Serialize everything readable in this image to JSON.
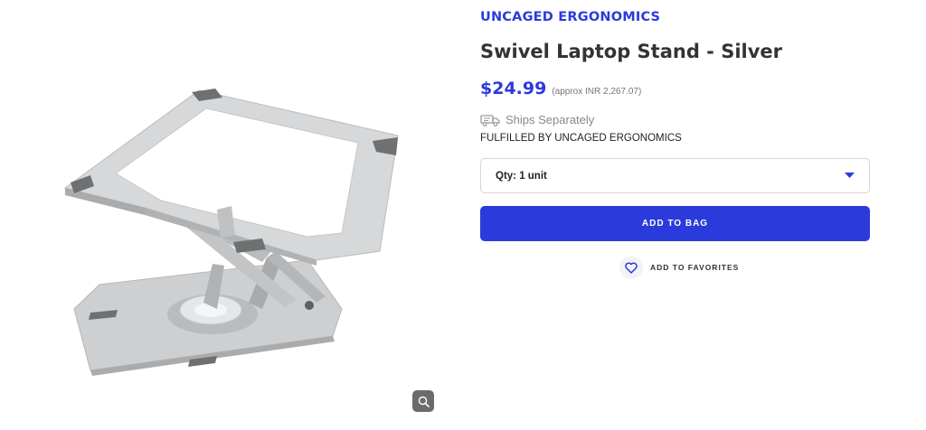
{
  "product": {
    "brand": "UNCAGED ERGONOMICS",
    "title": "Swivel Laptop Stand - Silver",
    "price": "$24.99",
    "approx_price": "(approx INR 2,267.07)",
    "shipping_text": "Ships Separately",
    "fulfilled_by": "FULFILLED BY UNCAGED ERGONOMICS"
  },
  "quantity": {
    "selected": "Qty: 1 unit"
  },
  "actions": {
    "add_to_bag": "ADD TO BAG",
    "add_to_favorites": "ADD TO FAVORITES"
  },
  "icons": {
    "zoom": "zoom-icon",
    "truck": "truck-icon",
    "dropdown": "caret-down-icon",
    "favorite": "heart-icon"
  },
  "colors": {
    "accent": "#2b3bdb",
    "text_dark": "#333333",
    "text_muted": "#888888",
    "zoom_button": "#6b6b6b"
  }
}
